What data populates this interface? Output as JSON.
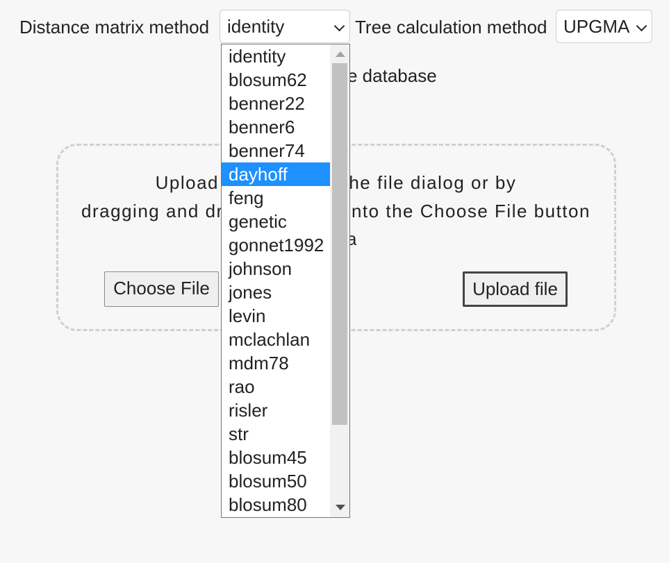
{
  "controls": {
    "distance_label": "Distance matrix method",
    "distance_value": "identity",
    "tree_label": "Tree calculation method",
    "tree_value": "UPGMA"
  },
  "partially_hidden": {
    "database_text": "e database"
  },
  "upload": {
    "line1": "Upload files through the file dialog or by",
    "line2": "dragging and dropping them onto the Choose File button",
    "line3_fragment": "a",
    "choose_label": "Choose File",
    "upload_label": "Upload file"
  },
  "dropdown": {
    "selected": "dayhoff",
    "options": [
      "identity",
      "blosum62",
      "benner22",
      "benner6",
      "benner74",
      "dayhoff",
      "feng",
      "genetic",
      "gonnet1992",
      "johnson",
      "jones",
      "levin",
      "mclachlan",
      "mdm78",
      "rao",
      "risler",
      "str",
      "blosum45",
      "blosum50",
      "blosum80"
    ]
  },
  "colors": {
    "selection": "#1e90ff",
    "background": "#f7f7f7"
  }
}
